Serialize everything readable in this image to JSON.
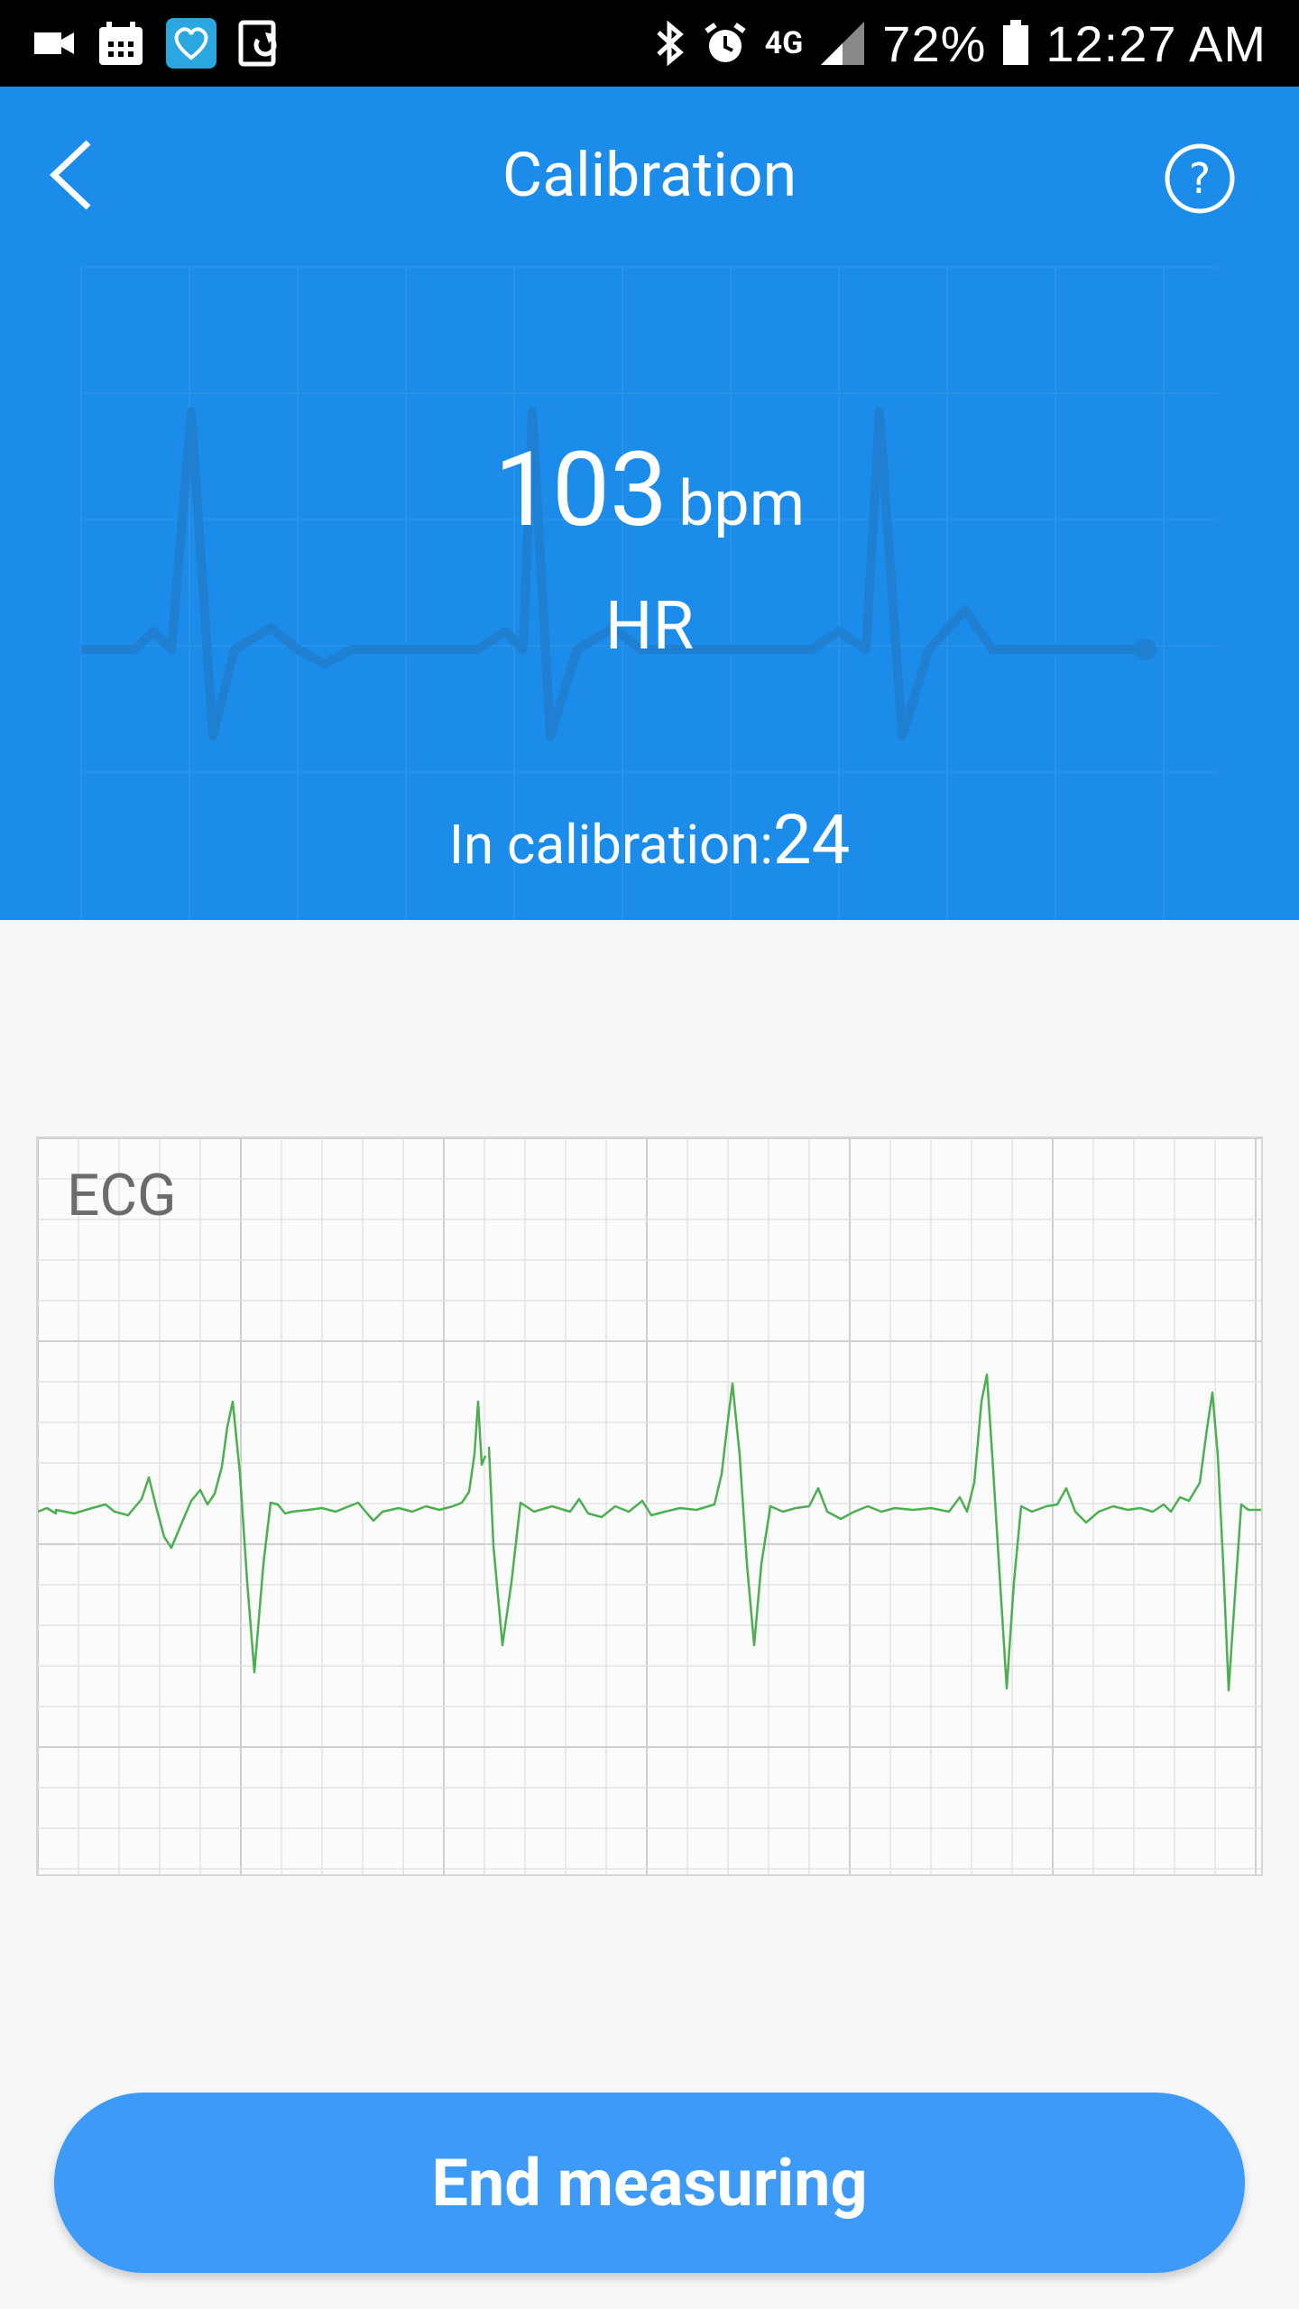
{
  "status_bar": {
    "battery": "72%",
    "time": "12:27 AM",
    "network": "4G",
    "icons": [
      "video-icon",
      "calendar-icon",
      "health-app-icon",
      "sync-icon",
      "bluetooth-icon",
      "alarm-icon",
      "network-4g-icon",
      "signal-icon",
      "battery-icon"
    ]
  },
  "header": {
    "title": "Calibration",
    "back_icon": "chevron-left-icon",
    "help_icon": "question-circle-icon",
    "heart_rate": "103",
    "unit": "bpm",
    "metric": "HR",
    "calibration_label": "In calibration:",
    "calibration_count": "24",
    "color": "#1b8ce9"
  },
  "ecg": {
    "label": "ECG",
    "trace_color": "#4caf50",
    "grid_color": "#e3e3e3",
    "grid_major_color": "#cfcfcf"
  },
  "actions": {
    "end_label": "End measuring",
    "button_color": "#3d9bf7"
  }
}
